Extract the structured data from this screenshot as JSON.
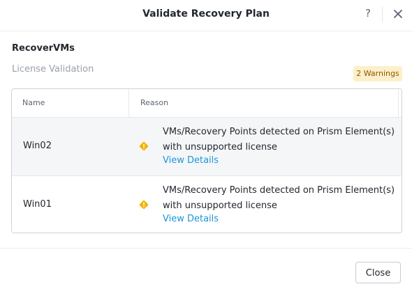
{
  "dialog": {
    "title": "Validate Recovery Plan",
    "help_label": "?",
    "close_icon": "close-icon",
    "help_icon": "help-icon"
  },
  "section": {
    "title": "RecoverVMs",
    "subtitle": "License Validation"
  },
  "badge": {
    "label": "2 Warnings",
    "color": "#fdefc9",
    "text_color": "#8a5a00"
  },
  "table": {
    "columns": [
      "Name",
      "Reason"
    ],
    "rows": [
      {
        "name": "Win02",
        "icon": "warning-icon",
        "reason_line1": "VMs/Recovery Points detected on Prism Element(s)",
        "reason_line2": "with unsupported license",
        "link": "View Details"
      },
      {
        "name": "Win01",
        "icon": "warning-icon",
        "reason_line1": "VMs/Recovery Points detected on Prism Element(s)",
        "reason_line2": "with unsupported license",
        "link": "View Details"
      }
    ]
  },
  "footer": {
    "close_label": "Close"
  },
  "colors": {
    "accent_link": "#1b96d8",
    "warning": "#f2b400"
  }
}
